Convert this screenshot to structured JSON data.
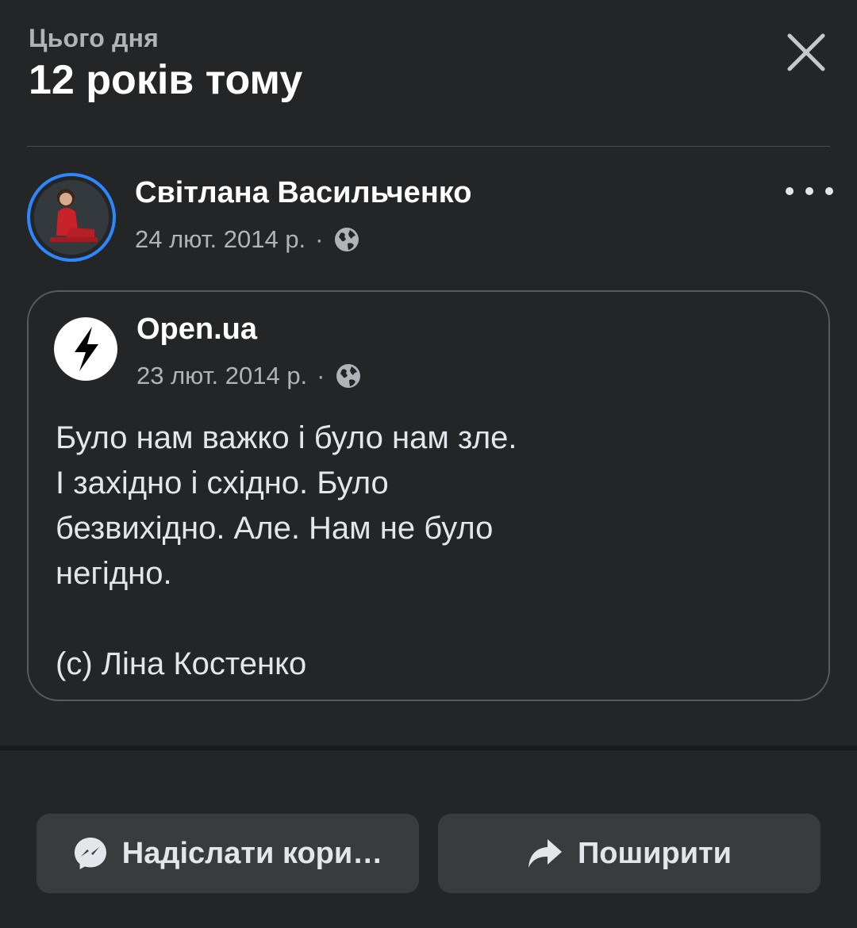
{
  "header": {
    "subtitle": "Цього дня",
    "title": "12 років тому",
    "close_icon": "close-icon"
  },
  "post": {
    "author": "Світлана Васильченко",
    "date": "24 лют. 2014 р.",
    "separator": "·",
    "privacy_icon": "globe-icon",
    "more_icon": "more-horizontal-icon"
  },
  "shared": {
    "page_name": "Open.ua",
    "date": "23 лют. 2014 р.",
    "separator": "·",
    "privacy_icon": "globe-icon",
    "text": "Було нам важко і було нам зле.\nІ західно і східно. Було\nбезвихідно. Але. Нам не було\nнегідно.\n\n(с) Ліна Костенко"
  },
  "actions": {
    "send_label": "Надіслати кори…",
    "send_icon": "messenger-icon",
    "share_label": "Поширити",
    "share_icon": "share-arrow-icon"
  },
  "colors": {
    "background": "#242526",
    "button": "#3a3b3c",
    "accent_ring": "#2d88ff",
    "text_primary": "#e4e6eb",
    "text_secondary": "#b0b3b8"
  }
}
